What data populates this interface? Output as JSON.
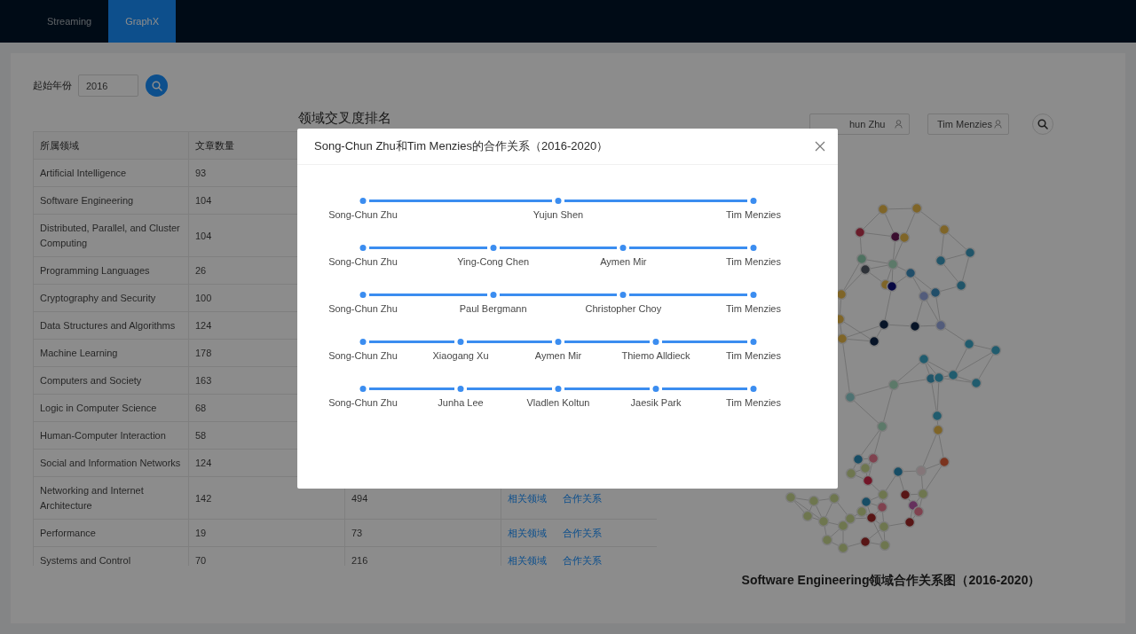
{
  "nav": {
    "tabs": [
      {
        "label": "Streaming",
        "selected": false
      },
      {
        "label": "GraphX",
        "selected": true
      }
    ]
  },
  "filter": {
    "label": "起始年份",
    "value": "2016"
  },
  "ranking": {
    "title": "领域交叉度排名",
    "columns": [
      "所属领域",
      "文章数量"
    ],
    "rows": [
      {
        "domain": "Artificial Intelligence",
        "count": "93"
      },
      {
        "domain": "Software Engineering",
        "count": "104"
      },
      {
        "domain": "Distributed, Parallel, and Cluster Computing",
        "count": "104"
      },
      {
        "domain": "Programming Languages",
        "count": "26"
      },
      {
        "domain": "Cryptography and Security",
        "count": "100"
      },
      {
        "domain": "Data Structures and Algorithms",
        "count": "124"
      },
      {
        "domain": "Machine Learning",
        "count": "178"
      },
      {
        "domain": "Computers and Society",
        "count": "163"
      },
      {
        "domain": "Logic in Computer Science",
        "count": "68"
      },
      {
        "domain": "Human-Computer Interaction",
        "count": "58"
      },
      {
        "domain": "Social and Information Networks",
        "count": "124"
      },
      {
        "domain": "Networking and Internet Architecture",
        "count": "142",
        "column_3": "494",
        "links": [
          "相关领域",
          "合作关系"
        ]
      },
      {
        "domain": "Performance",
        "count": "19",
        "column_3": "73",
        "links": [
          "相关领域",
          "合作关系"
        ]
      },
      {
        "domain": "Systems and Control",
        "count": "70",
        "column_3": "216",
        "links": [
          "相关领域",
          "合作关系"
        ]
      }
    ]
  },
  "collaboration": {
    "authors": [
      {
        "value": "hun Zhu"
      },
      {
        "value": "Tim Menzies"
      }
    ],
    "graph_title": "Software Engineering领域合作关系图（2016-2020）"
  },
  "modal": {
    "title": "Song-Chun Zhu和Tim Menzies的合作关系（2016-2020）",
    "paths": [
      {
        "nodes": [
          "Song-Chun Zhu",
          "Yujun Shen",
          "Tim Menzies"
        ]
      },
      {
        "nodes": [
          "Song-Chun Zhu",
          "Ying-Cong Chen",
          "Aymen Mir",
          "Tim Menzies"
        ]
      },
      {
        "nodes": [
          "Song-Chun Zhu",
          "Paul Bergmann",
          "Christopher Choy",
          "Tim Menzies"
        ]
      },
      {
        "nodes": [
          "Song-Chun Zhu",
          "Xiaogang Xu",
          "Aymen Mir",
          "Thiemo Alldieck",
          "Tim Menzies"
        ]
      },
      {
        "nodes": [
          "Song-Chun Zhu",
          "Junha Lee",
          "Vladlen Koltun",
          "Jaesik Park",
          "Tim Menzies"
        ]
      }
    ]
  }
}
